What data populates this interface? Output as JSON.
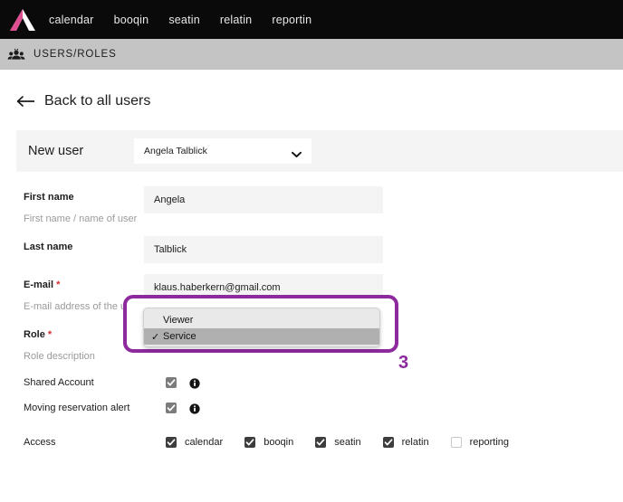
{
  "topnav": {
    "logo_name": "brand-logo",
    "logo_color_pink": "#de4f91",
    "links": [
      {
        "label": "calendar"
      },
      {
        "label": "booqin"
      },
      {
        "label": "seatin"
      },
      {
        "label": "relatin"
      },
      {
        "label": "reportin"
      }
    ]
  },
  "sectionbar": {
    "icon": "users-group-icon",
    "title": "USERS/ROLES"
  },
  "back": {
    "icon": "arrow-left-icon",
    "label": "Back to all users"
  },
  "newuser": {
    "label": "New user",
    "select": {
      "value": "Angela Talblick",
      "icon": "chevron-down-icon"
    }
  },
  "form": {
    "fields": [
      {
        "label": "First name",
        "required": false,
        "help": "First name / name of user",
        "value": "Angela"
      },
      {
        "label": "Last name",
        "required": false,
        "help": "",
        "value": "Talblick"
      },
      {
        "label": "E-mail",
        "required": true,
        "required_mark": "*",
        "help": "E-mail address of the user",
        "value": "klaus.haberkern@gmail.com"
      },
      {
        "label": "Role",
        "required": true,
        "required_mark": "*",
        "help": "Role description",
        "value": ""
      }
    ],
    "toggles": [
      {
        "label": "Shared Account",
        "checked": true,
        "info_icon": "info-icon"
      },
      {
        "label": "Moving reservation alert",
        "checked": true,
        "info_icon": "info-icon"
      }
    ],
    "access": {
      "label": "Access",
      "items": [
        {
          "label": "calendar",
          "checked": true
        },
        {
          "label": "booqin",
          "checked": true
        },
        {
          "label": "seatin",
          "checked": true
        },
        {
          "label": "relatin",
          "checked": true
        },
        {
          "label": "reporting",
          "checked": false
        }
      ]
    }
  },
  "dropdown": {
    "options": [
      {
        "label": "Viewer",
        "selected": false,
        "check": ""
      },
      {
        "label": "Service",
        "selected": true,
        "check": "✓"
      }
    ]
  },
  "annotation": {
    "number": "3",
    "color": "#8d2a9e"
  }
}
